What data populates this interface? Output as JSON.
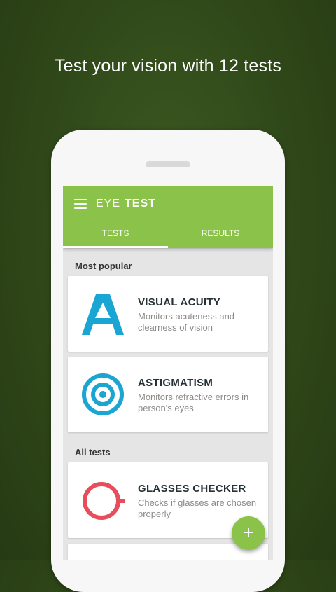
{
  "headline": "Test your vision with 12 tests",
  "app": {
    "title_light": "EYE",
    "title_bold": "TEST",
    "tabs": [
      "TESTS",
      "RESULTS"
    ],
    "accent": "#8bc34a"
  },
  "sections": {
    "popular_label": "Most popular",
    "all_label": "All tests"
  },
  "cards": [
    {
      "title": "VISUAL ACUITY",
      "desc": "Monitors acuteness and clearness of vision",
      "icon": "letter-a-icon",
      "icon_color": "#1aa5d3"
    },
    {
      "title": "ASTIGMATISM",
      "desc": "Monitors refractive errors in person's eyes",
      "icon": "target-icon",
      "icon_color": "#1aa5d3"
    },
    {
      "title": "GLASSES CHECKER",
      "desc": "Checks if glasses are chosen properly",
      "icon": "glasses-lens-icon",
      "icon_color": "#e84d5b"
    }
  ],
  "fab_label": "+"
}
